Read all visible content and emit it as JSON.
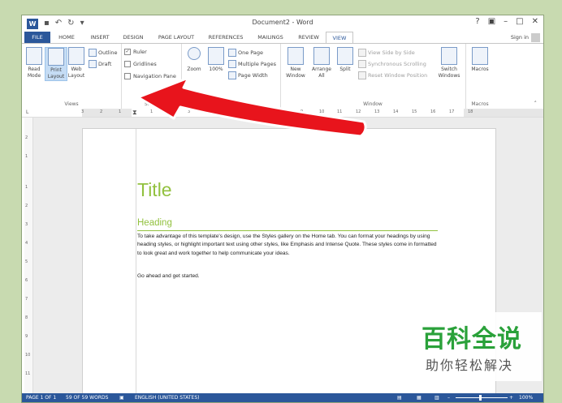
{
  "app": {
    "title": "Document2 - Word",
    "logo_letter": "W",
    "window_controls": [
      "?",
      "▣",
      "–",
      "□",
      "✕"
    ]
  },
  "tabs": [
    "FILE",
    "HOME",
    "INSERT",
    "DESIGN",
    "PAGE LAYOUT",
    "REFERENCES",
    "MAILINGS",
    "REVIEW",
    "VIEW"
  ],
  "active_tab": "VIEW",
  "signin_label": "Sign in",
  "ribbon": {
    "views": {
      "label": "Views",
      "read_mode": "Read Mode",
      "print_layout": "Print Layout",
      "web_layout": "Web Layout",
      "outline": "Outline",
      "draft": "Draft"
    },
    "show": {
      "label": "Show",
      "ruler": "Ruler",
      "gridlines": "Gridlines",
      "navigation_pane": "Navigation Pane",
      "ruler_checked": true
    },
    "zoom": {
      "label": "Zoom",
      "zoom": "Zoom",
      "hundred": "100%",
      "one_page": "One Page",
      "multiple_pages": "Multiple Pages",
      "page_width": "Page Width"
    },
    "window": {
      "label": "Window",
      "new_window": "New Window",
      "arrange_all": "Arrange All",
      "split": "Split",
      "view_side_by_side": "View Side by Side",
      "sync_scrolling": "Synchronous Scrolling",
      "reset_position": "Reset Window Position",
      "switch_windows": "Switch Windows"
    },
    "macros": {
      "label": "Macros",
      "macros": "Macros"
    }
  },
  "ruler_numbers": [
    "3",
    "2",
    "1",
    "1",
    "2",
    "3",
    "4",
    "5",
    "6",
    "7",
    "8",
    "9",
    "10",
    "11",
    "12",
    "13",
    "14",
    "15",
    "16",
    "17",
    "18"
  ],
  "vruler_numbers": [
    "2",
    "1",
    "1",
    "2",
    "3",
    "4",
    "5",
    "6",
    "7",
    "8",
    "9",
    "10",
    "11"
  ],
  "document": {
    "title": "Title",
    "heading": "Heading",
    "paragraph": "To take advantage of this template's design, use the Styles gallery on the Home tab. You can format your headings by using heading styles, or highlight important text using other styles, like Emphasis and Intense Quote. These styles come in formatted to look great and work together to help communicate your ideas.",
    "paragraph2": "Go ahead and get started."
  },
  "status": {
    "page": "PAGE 1 OF 1",
    "words": "59 OF 59 WORDS",
    "language": "ENGLISH (UNITED STATES)",
    "zoom": "100%"
  },
  "watermark": {
    "line1": "百科全说",
    "line2": "助你轻松解决"
  },
  "colors": {
    "accent": "#2b579a",
    "doc_green": "#92c13f",
    "arrow_red": "#e8141c",
    "background": "#c8dab0"
  }
}
